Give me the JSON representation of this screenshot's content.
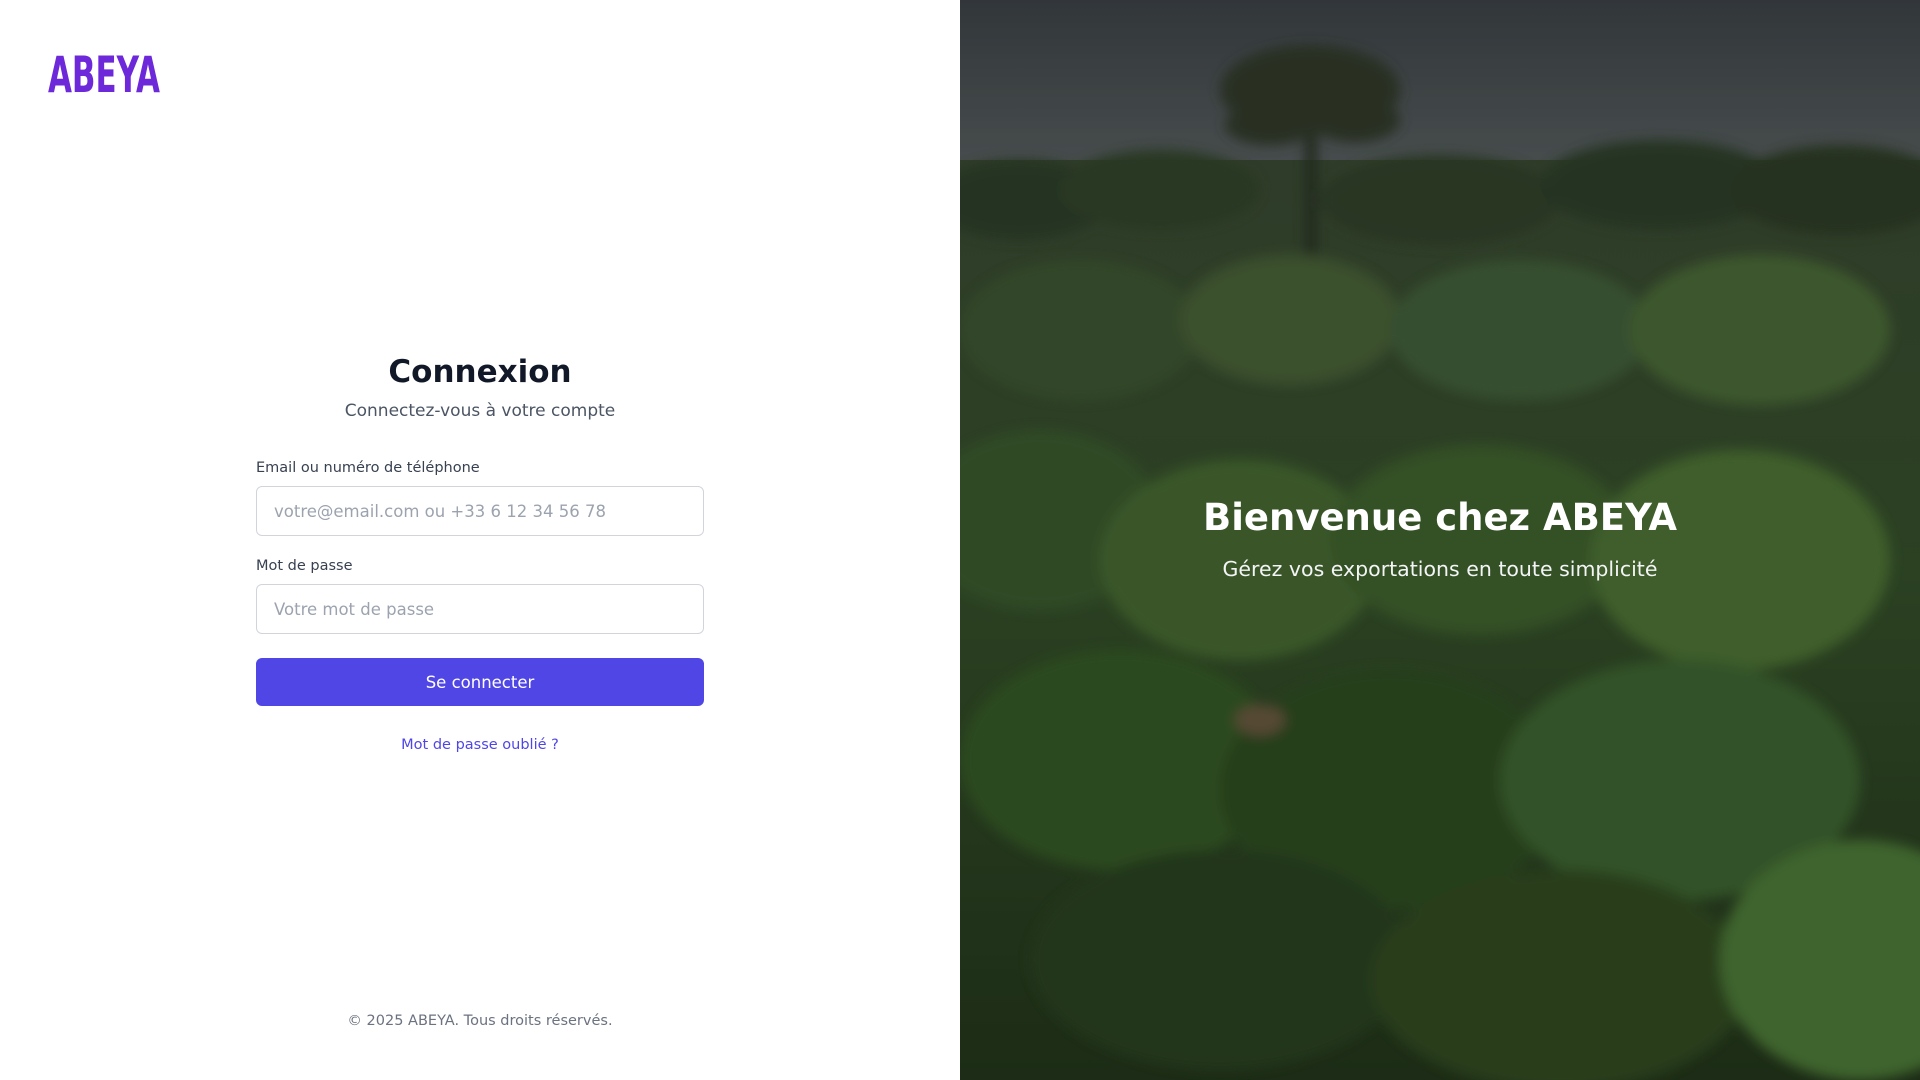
{
  "brand": {
    "logo_text": "ABEYA",
    "logo_color": "#6d28d9"
  },
  "login": {
    "title": "Connexion",
    "subtitle": "Connectez-vous à votre compte",
    "email_label": "Email ou numéro de téléphone",
    "email_placeholder": "votre@email.com ou +33 6 12 34 56 78",
    "email_value": "",
    "password_label": "Mot de passe",
    "password_placeholder": "Votre mot de passe",
    "password_value": "",
    "submit_label": "Se connecter",
    "forgot_label": "Mot de passe oublié ?"
  },
  "footer": {
    "copyright": "© 2025 ABEYA. Tous droits réservés."
  },
  "hero": {
    "title": "Bienvenue chez ABEYA",
    "subtitle": "Gérez vos exportations en toute simplicité",
    "image_description_icon": "forest-background-image"
  },
  "colors": {
    "primary": "#4f46e5",
    "title_text": "#111827",
    "muted_text": "#4b5563",
    "footer_text": "#6b7280"
  }
}
